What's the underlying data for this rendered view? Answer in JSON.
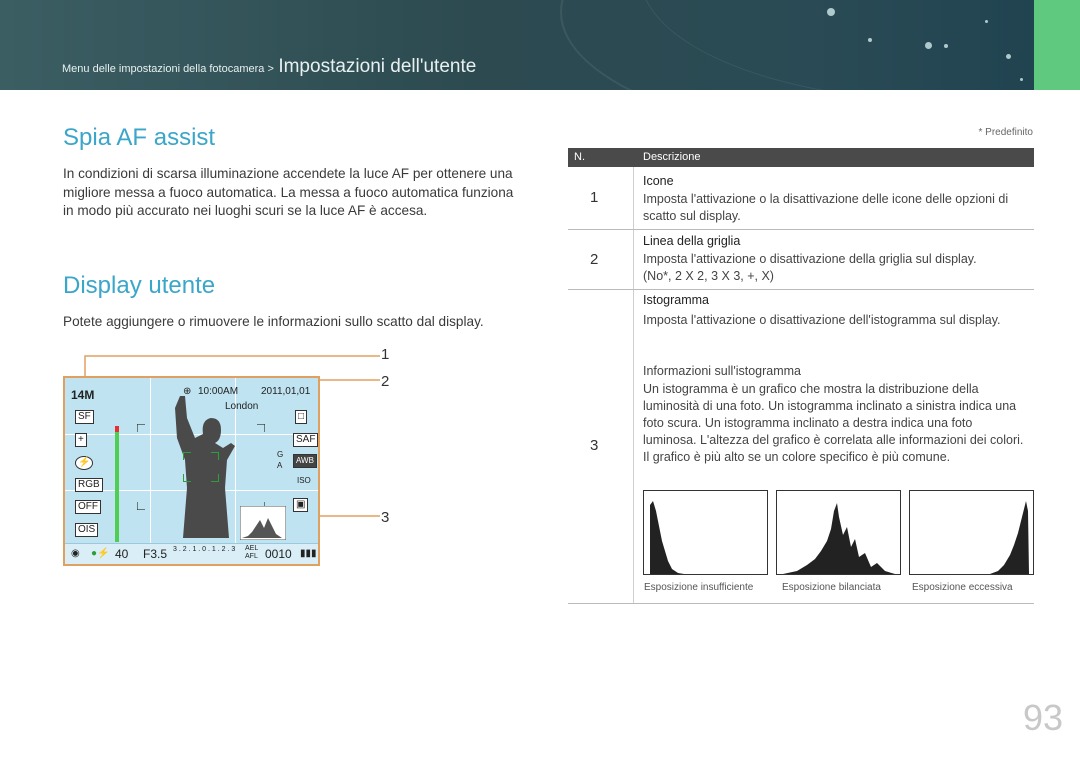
{
  "header": {
    "breadcrumb_parent": "Menu delle impostazioni della fotocamera >",
    "breadcrumb_current": "Impostazioni dell'utente"
  },
  "section1": {
    "title": "Spia AF assist",
    "text": "In condizioni di scarsa illuminazione accendete la luce AF per ottenere una migliore messa a fuoco automatica. La messa a fuoco automatica funziona in modo più accurato nei luoghi scuri se la luce AF è accesa."
  },
  "section2": {
    "title": "Display utente",
    "text": "Potete aggiungere o rimuovere le informazioni sullo scatto dal display."
  },
  "callouts": [
    "1",
    "2",
    "3"
  ],
  "camera_display": {
    "resolution": "14M",
    "time": "10:00AM",
    "date": "2011,01,01",
    "city": "London",
    "shots_left": "40",
    "aperture": "F3.5",
    "scale": "3 . 2 . 1 . 0 . 1 . 2 . 3",
    "ael": "AEL",
    "afl": "AFL",
    "counter": "0010",
    "g_label": "G",
    "a_label": "A",
    "awb": "AWB",
    "iso": "ISO",
    "s_label": "S",
    "rgb": "RGB",
    "off": "OFF",
    "ois": "OIS",
    "sf": "SF"
  },
  "table": {
    "note": "* Predefinito",
    "col_n": "N.",
    "col_desc": "Descrizione",
    "rows": [
      {
        "n": "1",
        "title": "Icone",
        "desc": "Imposta l'attivazione o la disattivazione delle icone delle opzioni di scatto sul display."
      },
      {
        "n": "2",
        "title": "Linea della griglia",
        "desc": "Imposta l'attivazione o disattivazione della griglia sul display.",
        "options": "(No*, 2 X 2, 3 X 3, +, X)"
      },
      {
        "n": "3",
        "title": "Istogramma",
        "desc": "Imposta l'attivazione o disattivazione dell'istogramma sul display.",
        "sub_title": "Informazioni sull'istogramma",
        "sub_desc": "Un istogramma è un grafico che mostra la distribuzione della luminosità di una foto. Un istogramma inclinato a sinistra indica una foto scura. Un istogramma inclinato a destra indica una foto luminosa. L'altezza del grafico è correlata alle informazioni dei colori. Il grafico è più alto se un colore specifico è più comune."
      }
    ],
    "histograms": [
      "Esposizione insufficiente",
      "Esposizione bilanciata",
      "Esposizione eccessiva"
    ]
  },
  "page_number": "93",
  "colors": {
    "accent": "#3aa6c9",
    "tab": "#5ec97f",
    "callout": "#e0a060"
  }
}
